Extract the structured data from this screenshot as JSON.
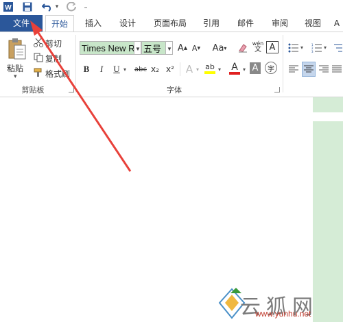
{
  "qat": {
    "undo_arrow": "▾",
    "more": "₌"
  },
  "tabs": [
    {
      "label": "文件"
    },
    {
      "label": "开始"
    },
    {
      "label": "插入"
    },
    {
      "label": "设计"
    },
    {
      "label": "页面布局"
    },
    {
      "label": "引用"
    },
    {
      "label": "邮件"
    },
    {
      "label": "审阅"
    },
    {
      "label": "视图"
    },
    {
      "label": "A"
    }
  ],
  "clipboard": {
    "paste_label": "粘贴",
    "cut_label": "剪切",
    "copy_label": "复制",
    "format_painter_label": "格式刷",
    "group_label": "剪贴板"
  },
  "font": {
    "font_name": "Times New R",
    "font_size": "五号",
    "grow": "A",
    "shrink": "A",
    "change_case": "Aa",
    "phonetic": "wén",
    "border_char": "A",
    "bold": "B",
    "italic": "I",
    "underline": "U",
    "strike": "abc",
    "subscript": "x₂",
    "superscript": "x²",
    "effects": "A",
    "highlight": "ab",
    "font_color": "A",
    "char_shading": "A",
    "enclose": "字",
    "group_label": "字体"
  },
  "colors": {
    "file_tab": "#2b579a",
    "highlight_bar": "#ffff00",
    "font_color_bar": "#e02020",
    "arrow": "#e8413a"
  },
  "watermark": {
    "text": "云狐网",
    "url": "www.yunhu.net"
  }
}
